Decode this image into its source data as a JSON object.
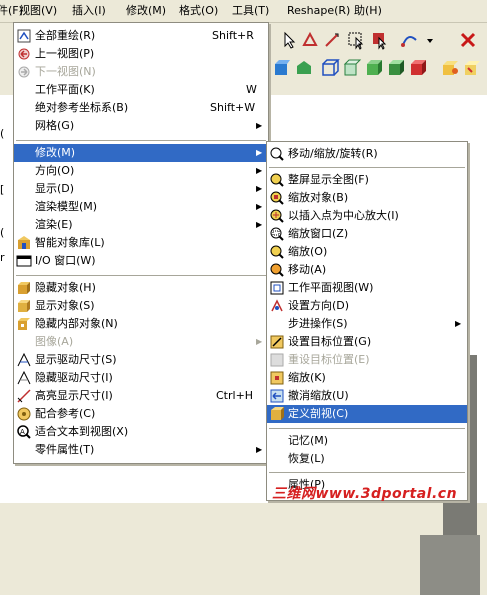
{
  "menubar": {
    "items": [
      {
        "label": "文件(F)"
      },
      {
        "label": "视图(V)"
      },
      {
        "label": "插入(I)"
      },
      {
        "label": "修改(M)"
      },
      {
        "label": "格式(O)"
      },
      {
        "label": "工具(T)"
      },
      {
        "label": "Reshape(R)"
      },
      {
        "label": "助(H)"
      }
    ]
  },
  "view_menu": {
    "items": [
      {
        "label": "全部重绘(R)",
        "shortcut": "Shift+R",
        "icon": "redraw-icon"
      },
      {
        "label": "上一视图(P)",
        "icon": "previous-view-icon"
      },
      {
        "label": "下一视图(N)",
        "disabled": true,
        "icon": "next-view-icon"
      },
      {
        "label": "工作平面(K)",
        "shortcut": "W"
      },
      {
        "label": "绝对参考坐标系(B)",
        "shortcut": "Shift+W"
      },
      {
        "label": "网格(G)",
        "submenu": true
      },
      {
        "label": "修改(M)",
        "submenu": true,
        "selected": true
      },
      {
        "label": "方向(O)",
        "submenu": true
      },
      {
        "label": "显示(D)",
        "submenu": true
      },
      {
        "label": "渲染模型(M)",
        "submenu": true
      },
      {
        "label": "渲染(E)",
        "submenu": true
      },
      {
        "label": "智能对象库(L)",
        "icon": "smart-object-library-icon"
      },
      {
        "label": "I/O 窗口(W)",
        "icon": "io-window-icon"
      },
      {
        "label": "隐藏对象(H)",
        "icon": "hide-object-icon"
      },
      {
        "label": "显示对象(S)",
        "icon": "show-object-icon"
      },
      {
        "label": "隐藏内部对象(N)",
        "icon": "hide-internal-object-icon"
      },
      {
        "label": "图像(A)",
        "submenu": true,
        "disabled": true
      },
      {
        "label": "显示驱动尺寸(S)",
        "icon": "show-driving-dimension-icon"
      },
      {
        "label": "隐藏驱动尺寸(I)",
        "icon": "hide-driving-dimension-icon"
      },
      {
        "label": "高亮显示尺寸(I)",
        "shortcut": "Ctrl+H",
        "icon": "highlight-dimension-icon"
      },
      {
        "label": "配合参考(C)",
        "icon": "mate-reference-icon"
      },
      {
        "label": "适合文本到视图(X)",
        "icon": "fit-text-icon"
      },
      {
        "label": "零件属性(T)",
        "submenu": true
      }
    ]
  },
  "modify_submenu": {
    "items": [
      {
        "label": "移动/缩放/旋转(R)",
        "icon": "move-scale-rotate-icon"
      },
      {
        "label": "整屏显示全图(F)",
        "icon": "zoom-fit-icon"
      },
      {
        "label": "缩放对象(B)",
        "icon": "zoom-object-icon"
      },
      {
        "label": "以插入点为中心放大(I)",
        "icon": "zoom-insert-point-icon"
      },
      {
        "label": "缩放窗口(Z)",
        "icon": "zoom-window-icon"
      },
      {
        "label": "缩放(O)",
        "icon": "zoom-icon"
      },
      {
        "label": "移动(A)",
        "icon": "pan-icon"
      },
      {
        "label": "工作平面视图(W)",
        "icon": "workplane-view-icon"
      },
      {
        "label": "设置方向(D)",
        "icon": "set-orientation-icon"
      },
      {
        "label": "步进操作(S)",
        "submenu": true
      },
      {
        "label": "设置目标位置(G)",
        "icon": "set-target-icon"
      },
      {
        "label": "重设目标位置(E)",
        "disabled": true,
        "icon": "reset-target-icon"
      },
      {
        "label": "缩放(K)",
        "icon": "zoom-k-icon"
      },
      {
        "label": "撤消缩放(U)",
        "icon": "undo-zoom-icon"
      },
      {
        "label": "定义剖视(C)",
        "selected": true,
        "icon": "define-section-icon"
      },
      {
        "label": "记忆(M)"
      },
      {
        "label": "恢复(L)"
      },
      {
        "label": "属性(P)"
      }
    ]
  },
  "side_fragments": {
    "a": "(",
    "b": "[",
    "c": "(",
    "d": "r"
  },
  "watermark": "三维网www.3dportal.cn",
  "colors": {
    "selection": "#316ac5",
    "menubar": "#ece9d8",
    "watermark": "#d62020"
  }
}
